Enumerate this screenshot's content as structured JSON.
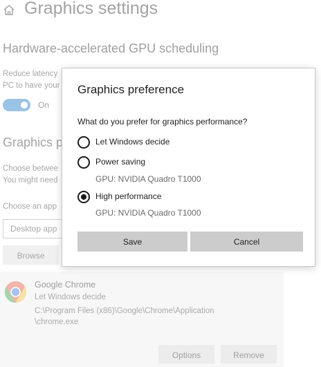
{
  "page": {
    "title": "Graphics settings",
    "gpu_section": {
      "heading": "Hardware-accelerated GPU scheduling",
      "desc_line1": "Reduce latency",
      "desc_line2": "PC to have your",
      "toggle_state": "On",
      "toggle_on": true
    },
    "graphics_pref_section": {
      "heading": "Graphics pe",
      "desc_line1": "Choose betwee",
      "desc_line2": "You might need",
      "choose_label": "Choose an app",
      "app_type_value": "Desktop app",
      "browse_label": "Browse"
    },
    "app_card": {
      "name": "Google Chrome",
      "preference": "Let Windows decide",
      "path_line1": "C:\\Program Files (x86)\\Google\\Chrome\\Application",
      "path_line2": "\\chrome.exe",
      "options_label": "Options",
      "remove_label": "Remove"
    }
  },
  "dialog": {
    "title": "Graphics preference",
    "question": "What do you prefer for graphics performance?",
    "options": [
      {
        "label": "Let Windows decide",
        "sub": "",
        "selected": false
      },
      {
        "label": "Power saving",
        "sub": "GPU: NVIDIA Quadro T1000",
        "selected": false
      },
      {
        "label": "High performance",
        "sub": "GPU: NVIDIA Quadro T1000",
        "selected": true
      }
    ],
    "save_label": "Save",
    "cancel_label": "Cancel"
  },
  "colors": {
    "accent": "#9ac3e6",
    "dialog_button": "#cccccc",
    "radio": "#1a1a1a"
  },
  "icons": {
    "home": "home-icon",
    "chrome": "chrome-icon"
  }
}
